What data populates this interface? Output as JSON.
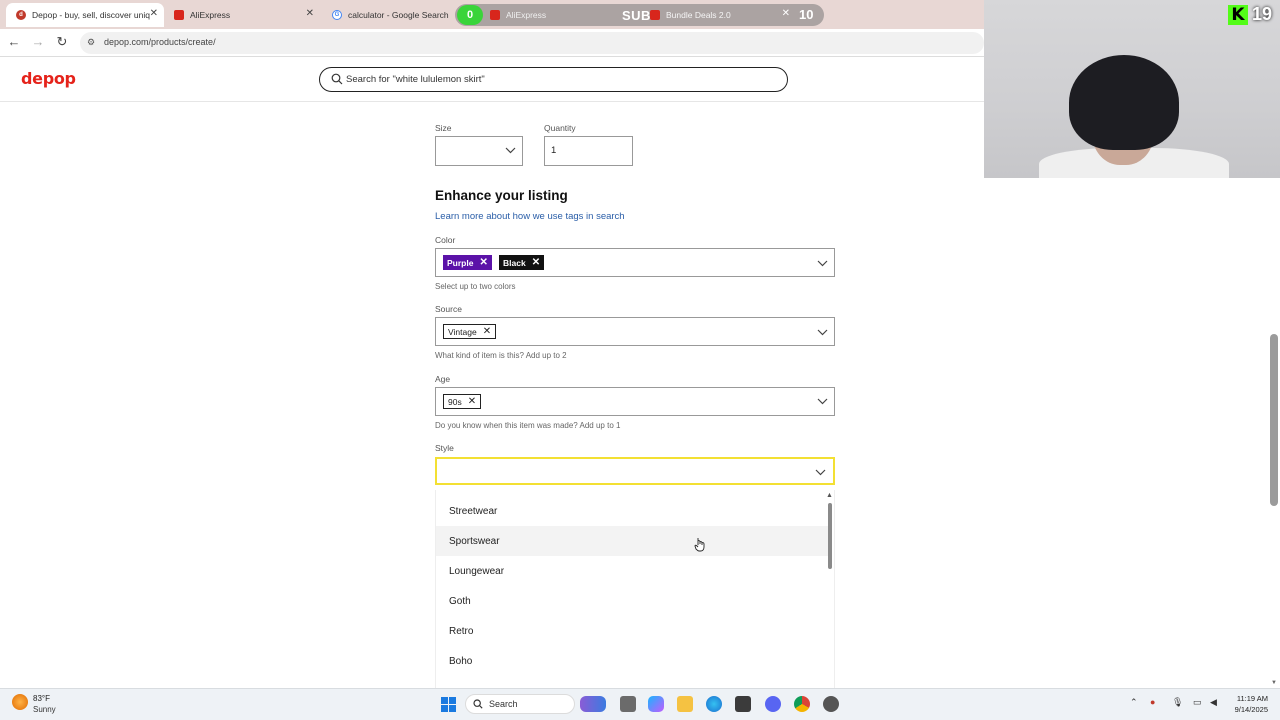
{
  "browser": {
    "tabs": [
      {
        "title": "Depop - buy, sell, discover uniq",
        "icon": "depop-favicon",
        "active": true
      },
      {
        "title": "AliExpress",
        "icon": "aliexpress-favicon"
      },
      {
        "title": "calculator - Google Search",
        "icon": "google-favicon"
      },
      {
        "title": "AliExpress",
        "icon": "aliexpress-favicon"
      },
      {
        "title": "Bundle Deals 2.0",
        "icon": "aliexpress-favicon"
      }
    ],
    "stream_overlay": {
      "badge_left": "0",
      "label": "SUBS",
      "count": "10"
    },
    "url": "depop.com/products/create/"
  },
  "site": {
    "logo": "depop",
    "search_placeholder": "Search for \"white lululemon skirt\"",
    "colors": {
      "brand": "#e5231b",
      "focus": "#f3e033",
      "chip_purple": "#5b12a8",
      "chip_black": "#111111"
    }
  },
  "form": {
    "size_label": "Size",
    "size_value": "",
    "quantity_label": "Quantity",
    "quantity_value": "1",
    "enhance_heading": "Enhance your listing",
    "tags_link": "Learn more about how we use tags in search",
    "color": {
      "label": "Color",
      "chips": [
        "Purple",
        "Black"
      ],
      "helper": "Select up to two colors"
    },
    "source": {
      "label": "Source",
      "chips": [
        "Vintage"
      ],
      "helper": "What kind of item is this? Add up to 2"
    },
    "age": {
      "label": "Age",
      "chips": [
        "90s"
      ],
      "helper": "Do you know when this item was made? Add up to 1"
    },
    "style": {
      "label": "Style",
      "value": "",
      "options": [
        "Streetwear",
        "Sportswear",
        "Loungewear",
        "Goth",
        "Retro",
        "Boho"
      ],
      "hovered": "Sportswear"
    }
  },
  "webcam": {
    "kick_count": "19"
  },
  "taskbar": {
    "weather_temp": "83°F",
    "weather_desc": "Sunny",
    "search_label": "Search",
    "time": "11:19 AM",
    "date": "9/14/2025"
  }
}
